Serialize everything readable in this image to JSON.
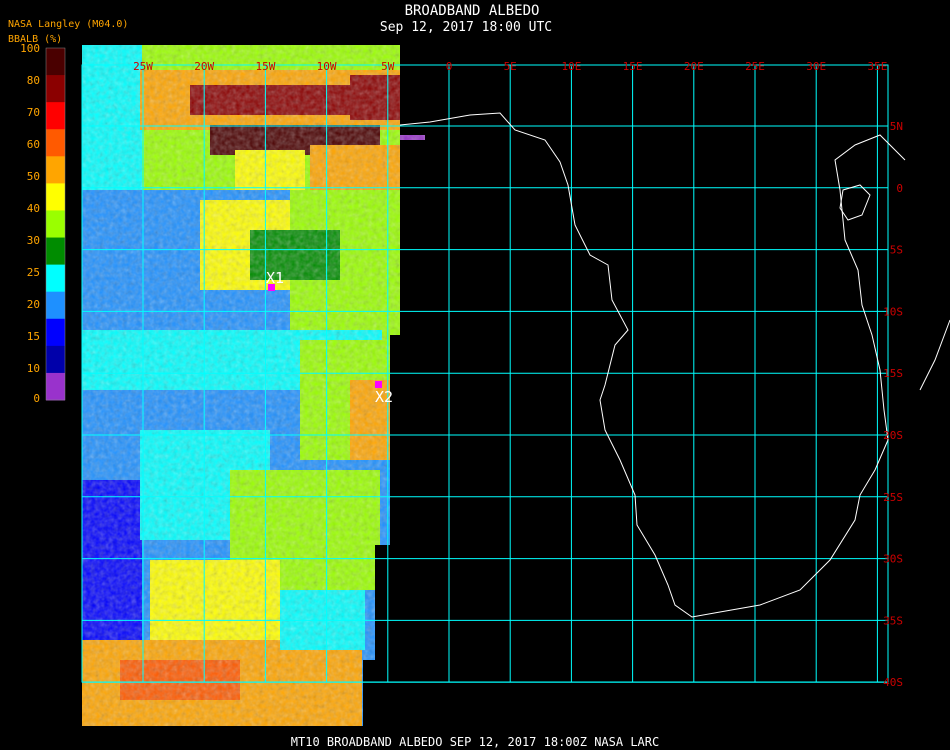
{
  "header": {
    "title": "BROADBAND ALBEDO",
    "subtitle": "Sep 12, 2017 18:00 UTC"
  },
  "legend": {
    "source": "NASA Langley (M04.0)",
    "unit": "BBALB (%)",
    "ticks": [
      "100",
      "80",
      "70",
      "60",
      "50",
      "40",
      "30",
      "25",
      "20",
      "15",
      "10",
      "0"
    ],
    "colors": [
      "#4a0000",
      "#8b0000",
      "#ff0000",
      "#ff5a00",
      "#ffa500",
      "#ffff00",
      "#9aff00",
      "#008c00",
      "#00ffff",
      "#1e90ff",
      "#0000ff",
      "#0000aa",
      "#9932cc"
    ]
  },
  "map": {
    "lon_labels": [
      "25W",
      "20W",
      "15W",
      "10W",
      "5W",
      "0",
      "5E",
      "10E",
      "15E",
      "20E",
      "25E",
      "30E",
      "35E"
    ],
    "lat_labels": [
      "5N",
      "0",
      "5S",
      "10S",
      "15S",
      "20S",
      "25S",
      "30S",
      "35S",
      "40S"
    ],
    "grid_color": "#00ffff",
    "coast_color": "#ffffff",
    "label_color": "#cc0000",
    "markers": [
      {
        "label": "X1",
        "color": "#ff00ff"
      },
      {
        "label": "X2",
        "color": "#ff00ff"
      }
    ]
  },
  "footer": {
    "caption": "MT10   BROADBAND ALBEDO   SEP 12, 2017 18:00Z   NASA LARC"
  }
}
